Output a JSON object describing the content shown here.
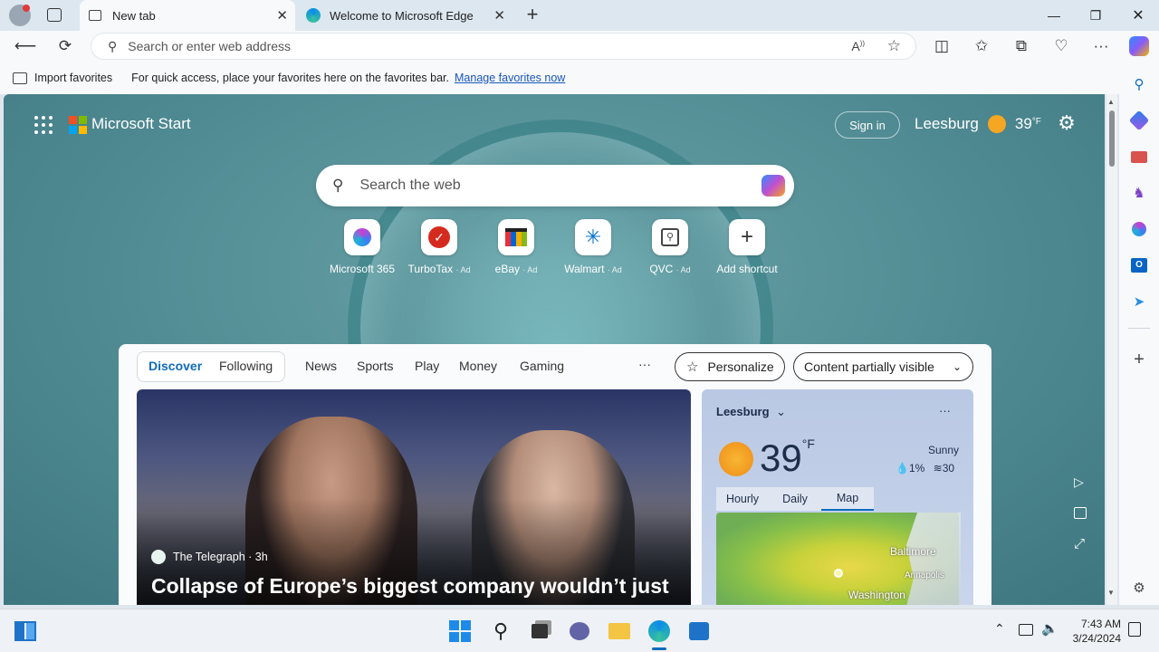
{
  "tabs": [
    {
      "label": "New tab",
      "active": true
    },
    {
      "label": "Welcome to Microsoft Edge",
      "active": false
    }
  ],
  "address": {
    "placeholder": "Search or enter web address"
  },
  "favorites_bar": {
    "import_label": "Import favorites",
    "hint": "For quick access, place your favorites here on the favorites bar.",
    "manage_link": "Manage favorites now"
  },
  "msn": {
    "brand": "Microsoft Start",
    "signin": "Sign in",
    "location": "Leesburg",
    "temp": "39",
    "unit": "°F",
    "search_placeholder": "Search the web"
  },
  "shortcuts": [
    {
      "label": "Microsoft 365",
      "ad": ""
    },
    {
      "label": "TurboTax",
      "ad": "· Ad"
    },
    {
      "label": "eBay",
      "ad": "· Ad"
    },
    {
      "label": "Walmart",
      "ad": "· Ad"
    },
    {
      "label": "QVC",
      "ad": "· Ad"
    },
    {
      "label": "Add shortcut",
      "ad": ""
    }
  ],
  "feed": {
    "tabs": [
      "Discover",
      "Following",
      "News",
      "Sports",
      "Play",
      "Money",
      "Gaming"
    ],
    "more": "···",
    "personalize": "Personalize",
    "visibility": "Content partially visible",
    "hero": {
      "source": "The Telegraph",
      "age": "· 3h",
      "headline": "Collapse of Europe’s biggest company wouldn’t just"
    },
    "weather": {
      "location": "Leesburg",
      "temp": "39",
      "unit": "°F",
      "condition": "Sunny",
      "precip": "1%",
      "wind": "30",
      "tabs": [
        "Hourly",
        "Daily",
        "Map"
      ],
      "map_labels": [
        "Baltimore",
        "Annapolis",
        "Washington"
      ]
    }
  },
  "taskbar": {
    "time": "7:43 AM",
    "date": "3/24/2024"
  },
  "colors": {
    "accent": "#0f6cbd",
    "link": "#1a55b8",
    "sun": "#f5a623"
  }
}
